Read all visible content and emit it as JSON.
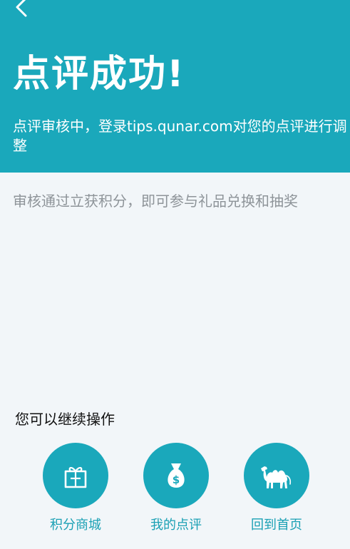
{
  "header": {
    "back_icon": "chevron-left-icon",
    "title": "点评成功!",
    "subtitle": "点评审核中，登录tips.qunar.com对您的点评进行调整"
  },
  "info": {
    "text": "审核通过立获积分，即可参与礼品兑换和抽奖"
  },
  "continue": {
    "label": "您可以继续操作"
  },
  "actions": [
    {
      "label": "积分商城",
      "icon": "gift-icon"
    },
    {
      "label": "我的点评",
      "icon": "money-bag-icon"
    },
    {
      "label": "回到首页",
      "icon": "camel-icon"
    }
  ],
  "colors": {
    "accent": "#1aa8bb",
    "background": "#f2f6f9",
    "muted_text": "#8e9499"
  }
}
